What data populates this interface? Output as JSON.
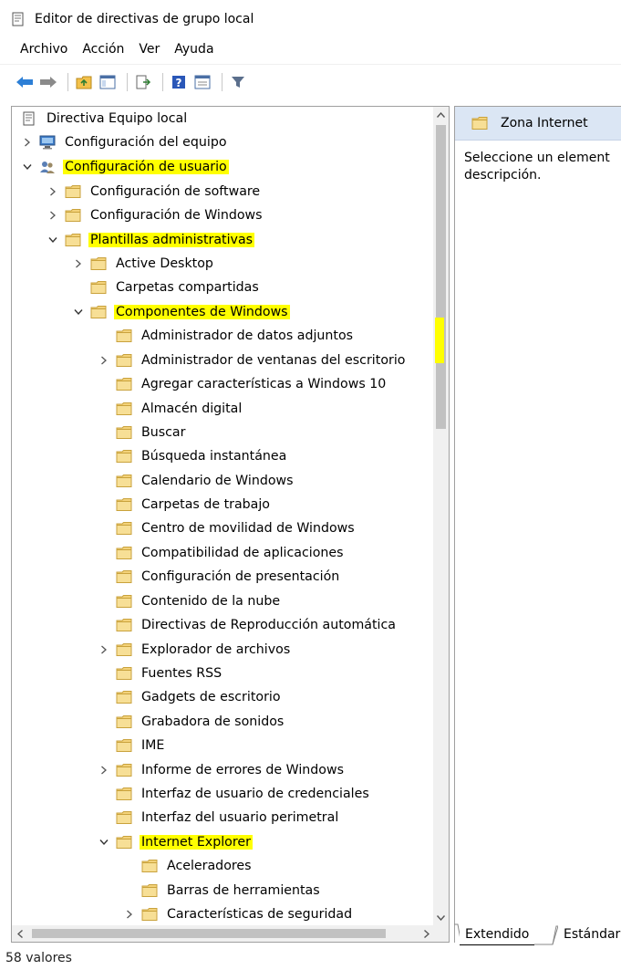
{
  "window": {
    "title": "Editor de directivas de grupo local",
    "icon": "policy-editor-icon"
  },
  "menu": [
    "Archivo",
    "Acción",
    "Ver",
    "Ayuda"
  ],
  "toolbar": {
    "buttons": [
      "back-arrow-icon",
      "forward-arrow-icon",
      "up-folder-icon",
      "show-hide-tree-icon",
      "export-list-icon",
      "help-icon",
      "properties-icon",
      "filter-icon"
    ]
  },
  "tree": {
    "items": [
      {
        "label": "Directiva Equipo local",
        "icon": "policy-doc-icon",
        "expander": "none",
        "highlight": false
      },
      {
        "label": "Configuración del equipo",
        "icon": "computer-icon",
        "expander": "collapsed",
        "highlight": false
      },
      {
        "label": "Configuración de usuario",
        "icon": "users-icon",
        "expander": "expanded",
        "highlight": true
      },
      {
        "label": "Configuración de software",
        "icon": "folder-icon",
        "expander": "collapsed",
        "highlight": false
      },
      {
        "label": "Configuración de Windows",
        "icon": "folder-icon",
        "expander": "collapsed",
        "highlight": false
      },
      {
        "label": "Plantillas administrativas",
        "icon": "folder-icon",
        "expander": "expanded",
        "highlight": true
      },
      {
        "label": "Active Desktop",
        "icon": "folder-icon",
        "expander": "collapsed",
        "highlight": false
      },
      {
        "label": "Carpetas compartidas",
        "icon": "folder-icon",
        "expander": "none",
        "highlight": false
      },
      {
        "label": "Componentes de Windows",
        "icon": "folder-icon",
        "expander": "expanded",
        "highlight": true
      },
      {
        "label": "Administrador de datos adjuntos",
        "icon": "folder-icon",
        "expander": "none",
        "highlight": false
      },
      {
        "label": "Administrador de ventanas del escritorio",
        "icon": "folder-icon",
        "expander": "collapsed",
        "highlight": false
      },
      {
        "label": "Agregar características a Windows 10",
        "icon": "folder-icon",
        "expander": "none",
        "highlight": false
      },
      {
        "label": "Almacén digital",
        "icon": "folder-icon",
        "expander": "none",
        "highlight": false
      },
      {
        "label": "Buscar",
        "icon": "folder-icon",
        "expander": "none",
        "highlight": false
      },
      {
        "label": "Búsqueda instantánea",
        "icon": "folder-icon",
        "expander": "none",
        "highlight": false
      },
      {
        "label": "Calendario de Windows",
        "icon": "folder-icon",
        "expander": "none",
        "highlight": false
      },
      {
        "label": "Carpetas de trabajo",
        "icon": "folder-icon",
        "expander": "none",
        "highlight": false
      },
      {
        "label": "Centro de movilidad de Windows",
        "icon": "folder-icon",
        "expander": "none",
        "highlight": false
      },
      {
        "label": "Compatibilidad de aplicaciones",
        "icon": "folder-icon",
        "expander": "none",
        "highlight": false
      },
      {
        "label": "Configuración de presentación",
        "icon": "folder-icon",
        "expander": "none",
        "highlight": false
      },
      {
        "label": "Contenido de la nube",
        "icon": "folder-icon",
        "expander": "none",
        "highlight": false
      },
      {
        "label": "Directivas de Reproducción automática",
        "icon": "folder-icon",
        "expander": "none",
        "highlight": false
      },
      {
        "label": "Explorador de archivos",
        "icon": "folder-icon",
        "expander": "collapsed",
        "highlight": false
      },
      {
        "label": "Fuentes RSS",
        "icon": "folder-icon",
        "expander": "none",
        "highlight": false
      },
      {
        "label": "Gadgets de escritorio",
        "icon": "folder-icon",
        "expander": "none",
        "highlight": false
      },
      {
        "label": "Grabadora de sonidos",
        "icon": "folder-icon",
        "expander": "none",
        "highlight": false
      },
      {
        "label": "IME",
        "icon": "folder-icon",
        "expander": "none",
        "highlight": false
      },
      {
        "label": "Informe de errores de Windows",
        "icon": "folder-icon",
        "expander": "collapsed",
        "highlight": false
      },
      {
        "label": "Interfaz de usuario de credenciales",
        "icon": "folder-icon",
        "expander": "none",
        "highlight": false
      },
      {
        "label": "Interfaz del usuario perimetral",
        "icon": "folder-icon",
        "expander": "none",
        "highlight": false
      },
      {
        "label": "Internet Explorer",
        "icon": "folder-icon",
        "expander": "expanded",
        "highlight": true
      },
      {
        "label": "Aceleradores",
        "icon": "folder-icon",
        "expander": "none",
        "highlight": false
      },
      {
        "label": "Barras de herramientas",
        "icon": "folder-icon",
        "expander": "none",
        "highlight": false
      },
      {
        "label": "Características de seguridad",
        "icon": "folder-icon",
        "expander": "collapsed",
        "highlight": false
      }
    ]
  },
  "details": {
    "header": "Zona Internet",
    "description_line1": "Seleccione un element",
    "description_line2": "descripción."
  },
  "tabs": [
    "Extendido",
    "Estándar"
  ],
  "status": "58 valores",
  "colors": {
    "highlight": "#ffff00",
    "header_bg": "#dbe6f4",
    "folder": "#f3d27a"
  }
}
